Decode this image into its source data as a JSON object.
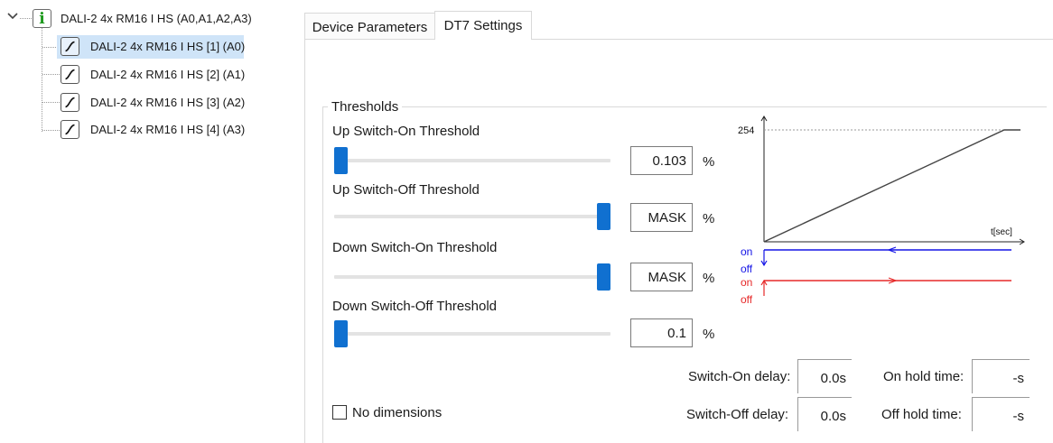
{
  "tree": {
    "root": {
      "label": "DALI-2 4x RM16 I HS (A0,A1,A2,A3)",
      "icon": "info-icon"
    },
    "children": [
      {
        "label": "DALI-2 4x RM16 I HS [1] (A0)",
        "icon": "dimmer-curve-icon",
        "selected": true
      },
      {
        "label": "DALI-2 4x RM16 I HS [2] (A1)",
        "icon": "dimmer-curve-icon",
        "selected": false
      },
      {
        "label": "DALI-2 4x RM16 I HS [3] (A2)",
        "icon": "dimmer-curve-icon",
        "selected": false
      },
      {
        "label": "DALI-2 4x RM16 I HS [4] (A3)",
        "icon": "dimmer-curve-icon",
        "selected": false
      }
    ]
  },
  "tabs": [
    {
      "label": "Device Parameters",
      "active": false
    },
    {
      "label": "DT7 Settings",
      "active": true
    }
  ],
  "thresholds": {
    "title": "Thresholds",
    "unit": "%",
    "items": [
      {
        "label": "Up Switch-On Threshold",
        "value": "0.103",
        "slider_level": 0.0
      },
      {
        "label": "Up Switch-Off Threshold",
        "value": "MASK",
        "slider_level": 1.0
      },
      {
        "label": "Down Switch-On Threshold",
        "value": "MASK",
        "slider_level": 1.0
      },
      {
        "label": "Down Switch-Off Threshold",
        "value": "0.1",
        "slider_level": 0.0
      }
    ]
  },
  "graph": {
    "y_max_label": "254",
    "x_axis_label": "t[sec]",
    "on_label": "on",
    "off_label": "off",
    "up_color": "#1414e6",
    "down_color": "#e62828"
  },
  "options": {
    "no_dimensions_label": "No dimensions",
    "no_dimensions_checked": false
  },
  "timing": {
    "switch_on_delay_label": "Switch-On delay:",
    "switch_on_delay_value": "0.0s",
    "switch_off_delay_label": "Switch-Off delay:",
    "switch_off_delay_value": "0.0s",
    "on_hold_label": "On hold time:",
    "on_hold_value": "-s",
    "off_hold_label": "Off hold time:",
    "off_hold_value": "-s"
  },
  "colors": {
    "accent": "#1070d0",
    "selection": "#cfe4f8",
    "info_green": "#1f9a1f"
  }
}
